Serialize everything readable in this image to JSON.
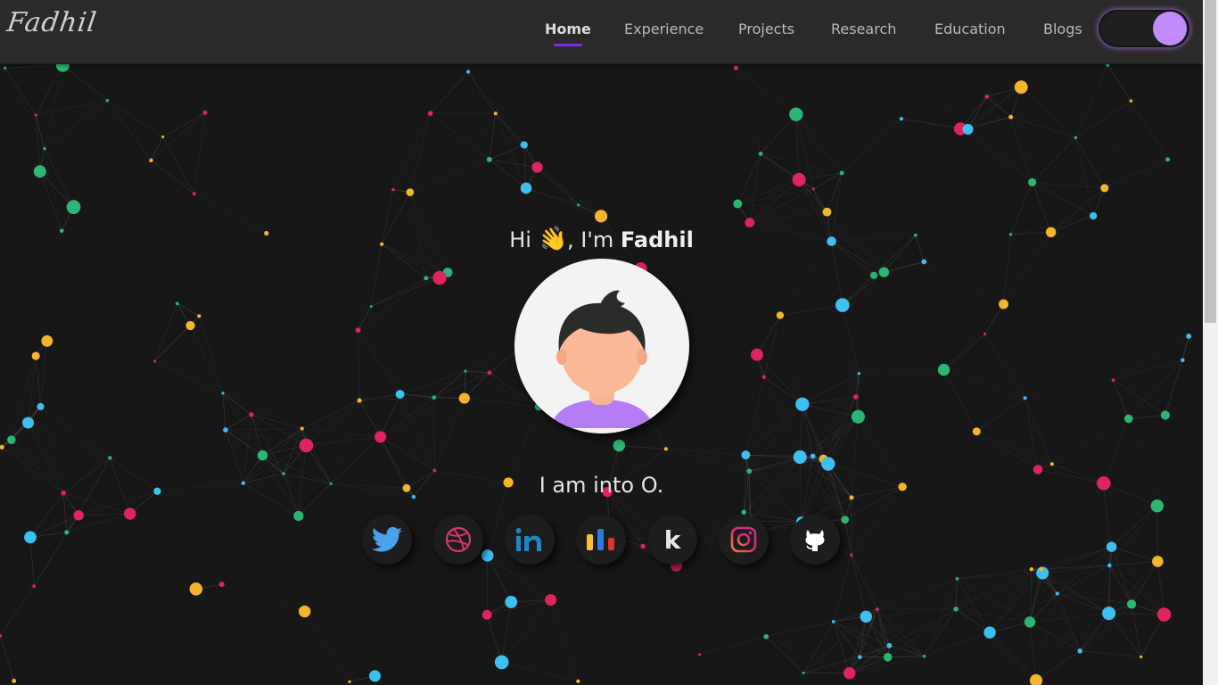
{
  "brand": {
    "logo_text": "Fadhil"
  },
  "nav": {
    "items": [
      {
        "label": "Home",
        "active": true
      },
      {
        "label": "Experience",
        "active": false
      },
      {
        "label": "Projects",
        "active": false
      },
      {
        "label": "Research",
        "active": false
      },
      {
        "label": "Education",
        "active": false
      },
      {
        "label": "Blogs",
        "active": false
      }
    ],
    "theme_toggle": {
      "state": "on"
    }
  },
  "hero": {
    "greeting_prefix": "Hi",
    "greeting_wave": "👋",
    "greeting_mid": ", I'm",
    "name": "Fadhil",
    "tagline": "I am into O."
  },
  "social_links": [
    {
      "name": "twitter",
      "icon": "twitter-icon"
    },
    {
      "name": "dribbble",
      "icon": "dribbble-icon"
    },
    {
      "name": "linkedin",
      "icon": "linkedin-icon"
    },
    {
      "name": "stats",
      "icon": "bar-chart-icon"
    },
    {
      "name": "kaggle",
      "icon": "kaggle-icon",
      "glyph": "k"
    },
    {
      "name": "instagram",
      "icon": "instagram-icon"
    },
    {
      "name": "github",
      "icon": "github-icon"
    }
  ],
  "colors": {
    "background": "#171717",
    "navbar": "#2a2a2a",
    "accent_purple": "#c08cfb",
    "nav_underline": "#7b2ff0",
    "particles": [
      "#2bb673",
      "#f4b52c",
      "#e0245e",
      "#3cc0f0"
    ]
  }
}
